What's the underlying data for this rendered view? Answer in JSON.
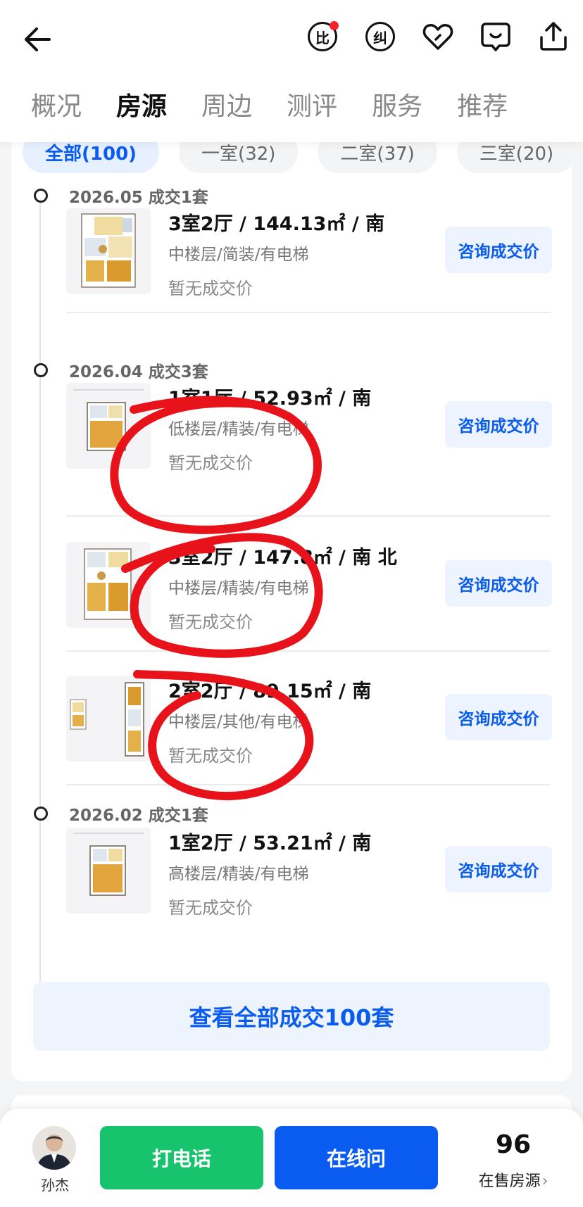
{
  "header": {
    "compare_label": "比",
    "correct_label": "纠",
    "tabs": [
      {
        "label": "概况",
        "active": false
      },
      {
        "label": "房源",
        "active": true
      },
      {
        "label": "周边",
        "active": false
      },
      {
        "label": "测评",
        "active": false
      },
      {
        "label": "服务",
        "active": false
      },
      {
        "label": "推荐",
        "active": false
      }
    ]
  },
  "chips": [
    "全部(100)",
    "一室(32)",
    "二室(37)",
    "三室(20)"
  ],
  "groups": [
    {
      "date": "2026.05 成交1套"
    },
    {
      "date": "2026.04 成交3套"
    },
    {
      "date": "2026.02 成交1套"
    }
  ],
  "listings": [
    {
      "title": "3室2厅 / 144.13㎡ / 南",
      "sub": "中楼层/简装/有电梯",
      "price": "暂无成交价",
      "button": "咨询成交价"
    },
    {
      "title": "1室1厅 / 52.93㎡ / 南",
      "sub": "低楼层/精装/有电梯",
      "price": "暂无成交价",
      "button": "咨询成交价"
    },
    {
      "title": "3室2厅 / 147.8㎡ / 南 北",
      "sub": "中楼层/精装/有电梯",
      "price": "暂无成交价",
      "button": "咨询成交价"
    },
    {
      "title": "2室2厅 / 89.15㎡ / 南",
      "sub": "中楼层/其他/有电梯",
      "price": "暂无成交价",
      "button": "咨询成交价"
    },
    {
      "title": "1室2厅 / 53.21㎡ / 南",
      "sub": "高楼层/精装/有电梯",
      "price": "暂无成交价",
      "button": "咨询成交价"
    }
  ],
  "view_all": "查看全部成交100套",
  "bottom": {
    "agent_name": "孙杰",
    "call_label": "打电话",
    "chat_label": "在线问",
    "sale_count": "96",
    "sale_label": "在售房源"
  },
  "colors": {
    "brand_blue": "#0a5cf0",
    "call_green": "#17c36c",
    "annotation_red": "#e8121b"
  }
}
